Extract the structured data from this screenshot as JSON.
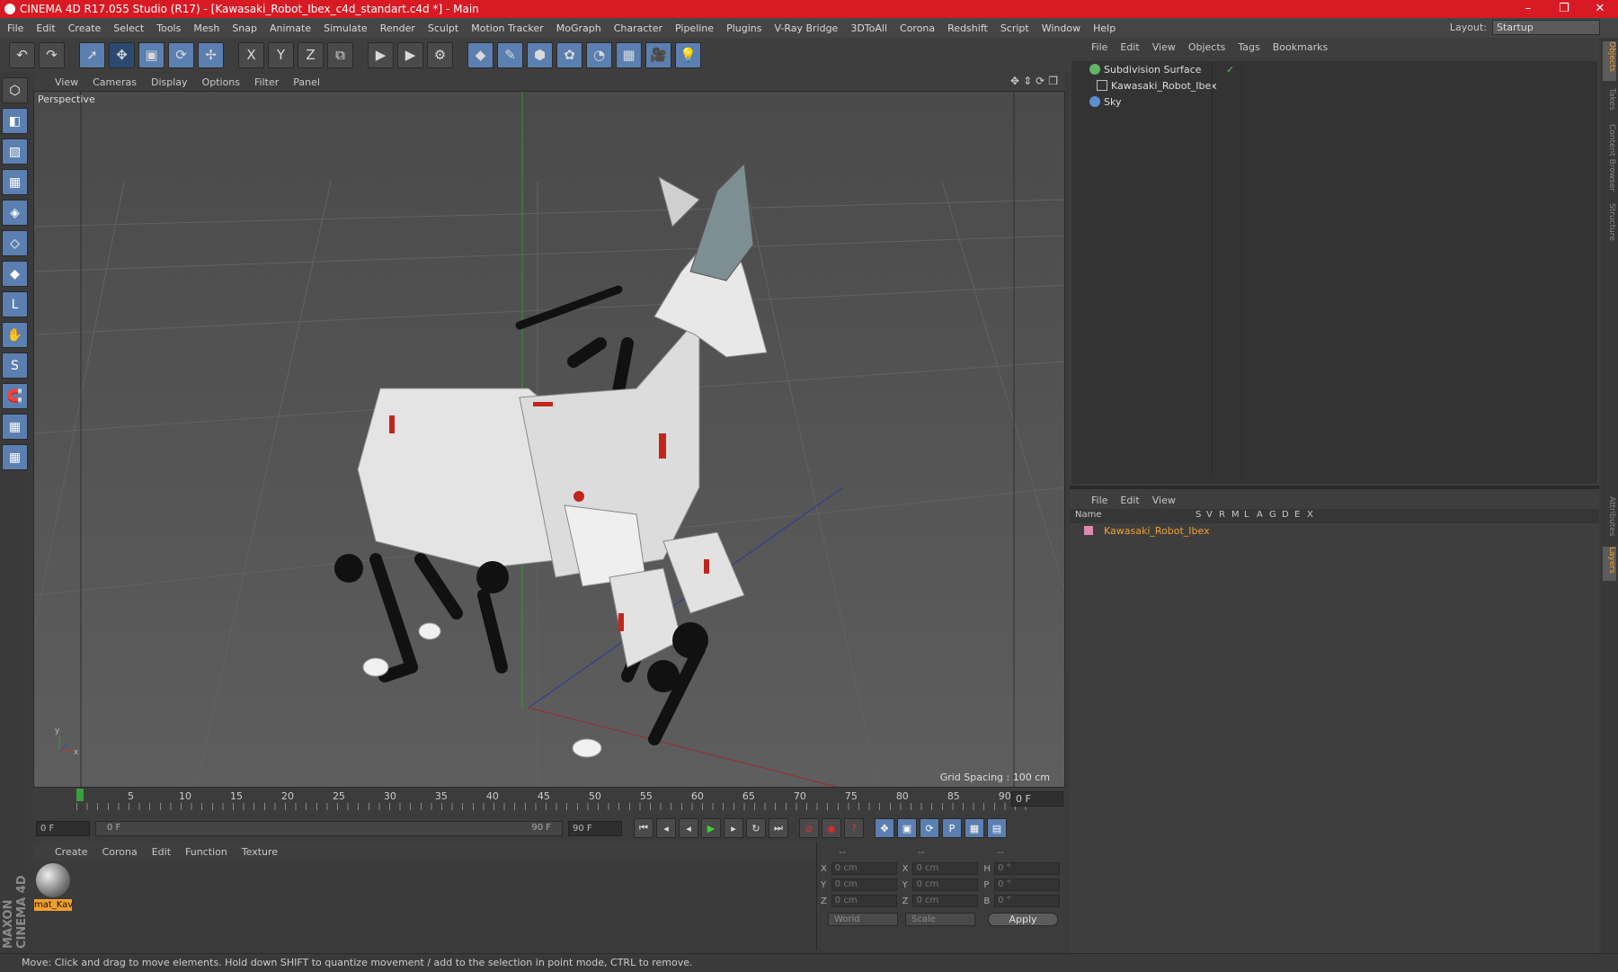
{
  "window": {
    "title": "CINEMA 4D R17.055 Studio (R17) - [Kawasaki_Robot_Ibex_c4d_standart.c4d *] - Main"
  },
  "menubar": {
    "items": [
      "File",
      "Edit",
      "Create",
      "Select",
      "Tools",
      "Mesh",
      "Snap",
      "Animate",
      "Simulate",
      "Render",
      "Sculpt",
      "Motion Tracker",
      "MoGraph",
      "Character",
      "Pipeline",
      "Plugins",
      "V-Ray Bridge",
      "3DToAll",
      "Corona",
      "Redshift",
      "Script",
      "Window",
      "Help"
    ],
    "layout_label": "Layout:",
    "layout_value": "Startup"
  },
  "toolbar": {
    "icons": [
      "undo-icon",
      "redo-icon",
      "select-arrow-icon",
      "move-icon",
      "scale-icon",
      "rotate-icon",
      "axis-move-icon",
      "x-axis-icon",
      "y-axis-icon",
      "z-axis-icon",
      "coordinate-system-icon",
      "render-view-icon",
      "render-picture-viewer-icon",
      "render-settings-icon",
      "cube-primitive-icon",
      "pen-spline-icon",
      "subdivision-icon",
      "cloner-icon",
      "deformer-icon",
      "floor-icon",
      "camera-icon",
      "light-icon"
    ],
    "glyphs": [
      "↶",
      "↷",
      "➚",
      "✥",
      "▣",
      "⟳",
      "✢",
      "X",
      "Y",
      "Z",
      "⧉",
      "▶",
      "▶",
      "⚙",
      "◆",
      "✎",
      "⬢",
      "✿",
      "◔",
      "▦",
      "🎥",
      "💡"
    ]
  },
  "left_tools": {
    "icons": [
      "make-editable-icon",
      "model-mode-icon",
      "texture-mode-icon",
      "workplane-icon",
      "points-mode-icon",
      "edges-mode-icon",
      "polygons-mode-icon",
      "axis-mode-icon",
      "tweak-mode-icon",
      "soft-selection-icon",
      "snapping-icon",
      "locked-workplane-icon",
      "planar-workplane-icon"
    ],
    "glyphs": [
      "⬡",
      "◧",
      "▨",
      "▦",
      "◈",
      "◇",
      "◆",
      "L",
      "✋",
      "S",
      "🧲",
      "▦",
      "▦"
    ]
  },
  "viewport": {
    "menu": [
      "View",
      "Cameras",
      "Display",
      "Options",
      "Filter",
      "Panel"
    ],
    "label": "Perspective",
    "grid_spacing": "Grid Spacing : 100 cm"
  },
  "timeline": {
    "ticks": [
      "0",
      "5",
      "10",
      "15",
      "20",
      "25",
      "30",
      "35",
      "40",
      "45",
      "50",
      "55",
      "60",
      "65",
      "70",
      "75",
      "80",
      "85",
      "90"
    ],
    "current_frame": "0 F"
  },
  "transport": {
    "start_field": "0 F",
    "range_start": "0 F",
    "range_end": "90 F",
    "end_field": "90 F",
    "buttons": [
      "goto-start-icon",
      "prev-key-icon",
      "play-back-icon",
      "play-icon",
      "next-key-icon",
      "loop-icon",
      "goto-end-icon",
      "record-off-icon",
      "autokey-icon",
      "keyframe-info-icon",
      "move-key-icon",
      "scale-key-icon",
      "rotate-key-icon",
      "param-key-icon",
      "pla-key-icon",
      "timeline-icon"
    ],
    "glyphs": [
      "⏮",
      "◂",
      "◂",
      "▶",
      "▸",
      "↻",
      "⏭",
      "⊘",
      "◉",
      "?",
      "✥",
      "▣",
      "⟳",
      "P",
      "▦",
      "▤"
    ]
  },
  "material": {
    "menu": [
      "Create",
      "Corona",
      "Edit",
      "Function",
      "Texture"
    ],
    "name": "mat_Kav"
  },
  "coords": {
    "header": [
      "--",
      "--",
      "--"
    ],
    "rows": [
      {
        "a": "X",
        "v1": "0 cm",
        "b": "X",
        "v2": "0 cm",
        "c": "H",
        "v3": "0 °"
      },
      {
        "a": "Y",
        "v1": "0 cm",
        "b": "Y",
        "v2": "0 cm",
        "c": "P",
        "v3": "0 °"
      },
      {
        "a": "Z",
        "v1": "0 cm",
        "b": "Z",
        "v2": "0 cm",
        "c": "B",
        "v3": "0 °"
      }
    ],
    "space": "World",
    "mode": "Scale",
    "apply": "Apply"
  },
  "objects": {
    "menu": [
      "File",
      "Edit",
      "View",
      "Objects",
      "Tags",
      "Bookmarks"
    ],
    "items": [
      "Subdivision Surface",
      "Kawasaki_Robot_Ibex",
      "Sky"
    ]
  },
  "layers": {
    "menu": [
      "File",
      "Edit",
      "View"
    ],
    "columns": [
      "Name",
      "S",
      "V",
      "R",
      "M",
      "L",
      "A",
      "G",
      "D",
      "E",
      "X"
    ],
    "row": "Kawasaki_Robot_Ibex",
    "accent": "#f0a030"
  },
  "side_tabs": [
    "Objects",
    "Takes",
    "Content Browser",
    "Structure",
    "Attributes",
    "Layers"
  ],
  "status": "Move: Click and drag to move elements. Hold down SHIFT to quantize movement / add to the selection in point mode, CTRL to remove.",
  "logo": "MAXON CINEMA 4D"
}
